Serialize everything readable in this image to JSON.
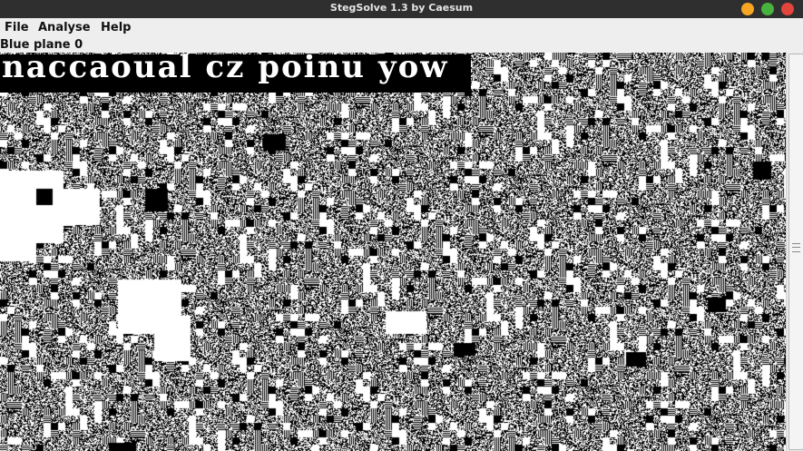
{
  "window": {
    "title": "StegSolve 1.3 by Caesum",
    "controls": [
      "minimize",
      "maximize",
      "close"
    ]
  },
  "menu": {
    "items": [
      "File",
      "Analyse",
      "Help"
    ]
  },
  "view": {
    "plane_label": "Blue plane 0",
    "hidden_text": "naccaoual cz poinu yow"
  },
  "colors": {
    "titlebar": "#2f2f2f",
    "menubar": "#eeeeee",
    "minimize": "#f6a623",
    "maximize": "#47b33e",
    "close": "#e2453c"
  }
}
